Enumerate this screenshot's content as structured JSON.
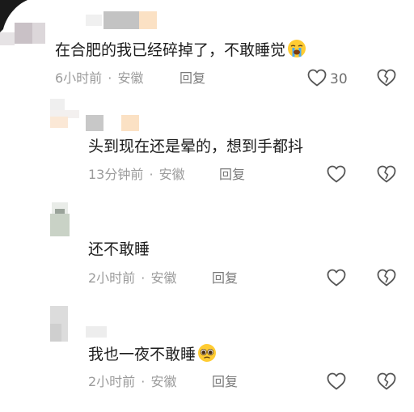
{
  "comments": [
    {
      "text": "在合肥的我已经碎掉了，不敢睡觉",
      "emoji": "loudly-crying-face",
      "time": "6小时前",
      "sep": "·",
      "location": "安徽",
      "reply_label": "回复",
      "likes": "30"
    },
    {
      "text": "头到现在还是晕的，想到手都抖",
      "time": "13分钟前",
      "sep": "·",
      "location": "安徽",
      "reply_label": "回复"
    },
    {
      "text": "还不敢睡",
      "time": "2小时前",
      "sep": "·",
      "location": "安徽",
      "reply_label": "回复"
    },
    {
      "text": "我也一夜不敢睡",
      "emoji": "pleading-face",
      "time": "2小时前",
      "sep": "·",
      "location": "安徽",
      "reply_label": "回复"
    }
  ],
  "icons": {
    "like": "heart-outline-icon",
    "dislike": "broken-heart-outline-icon"
  },
  "colors": {
    "text": "#1c1c1c",
    "meta": "#9b9b9b",
    "icon": "#555555"
  }
}
